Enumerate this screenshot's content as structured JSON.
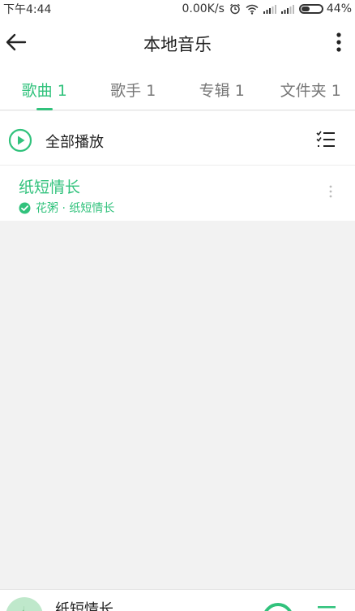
{
  "status_bar": {
    "time": "下午4:44",
    "speed": "0.00K/s",
    "battery": "44%",
    "battery_level": 0.44
  },
  "header": {
    "title": "本地音乐"
  },
  "tabs": [
    {
      "label": "歌曲 1",
      "active": true
    },
    {
      "label": "歌手 1",
      "active": false
    },
    {
      "label": "专辑 1",
      "active": false
    },
    {
      "label": "文件夹 1",
      "active": false
    }
  ],
  "play_all": {
    "label": "全部播放"
  },
  "songs": [
    {
      "title": "纸短情长",
      "meta": "花粥 · 纸短情长"
    }
  ],
  "player": {
    "title": "纸短情长"
  },
  "colors": {
    "accent": "#31c27c",
    "background": "#f2f2f2"
  }
}
